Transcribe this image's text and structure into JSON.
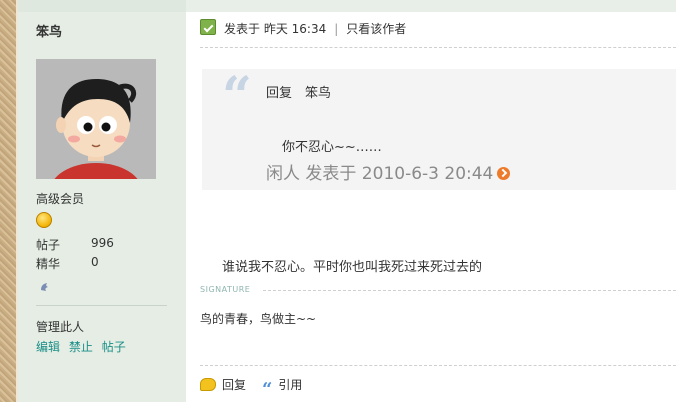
{
  "user": {
    "name": "笨鸟",
    "rank": "高级会员",
    "stats": [
      {
        "label": "帖子",
        "value": "996"
      },
      {
        "label": "精华",
        "value": "0"
      }
    ],
    "manage_label": "管理此人",
    "admin_links": [
      "编辑",
      "禁止",
      "帖子"
    ]
  },
  "post": {
    "posted_at": "发表于 昨天 16:34",
    "author_only": "只看该作者",
    "quote": {
      "head": "回复　笨鸟",
      "text": "你不忍心~~……",
      "footer": "闲人 发表于 2010-6-3 20:44"
    },
    "body": "谁说我不忍心。平时你也叫我死过来死过去的",
    "signature_label": "Signature",
    "signature": "鸟的青春，鸟做主~~"
  },
  "actions": {
    "reply": "回复",
    "quote": "引用"
  },
  "icons": {
    "post_status": "online-check-icon",
    "quote_mark": "quote-mark-icon",
    "goto": "goto-post-icon",
    "rank": "smiley-icon",
    "buddy": "add-buddy-icon",
    "reply": "reply-icon",
    "cite": "quote-icon"
  }
}
